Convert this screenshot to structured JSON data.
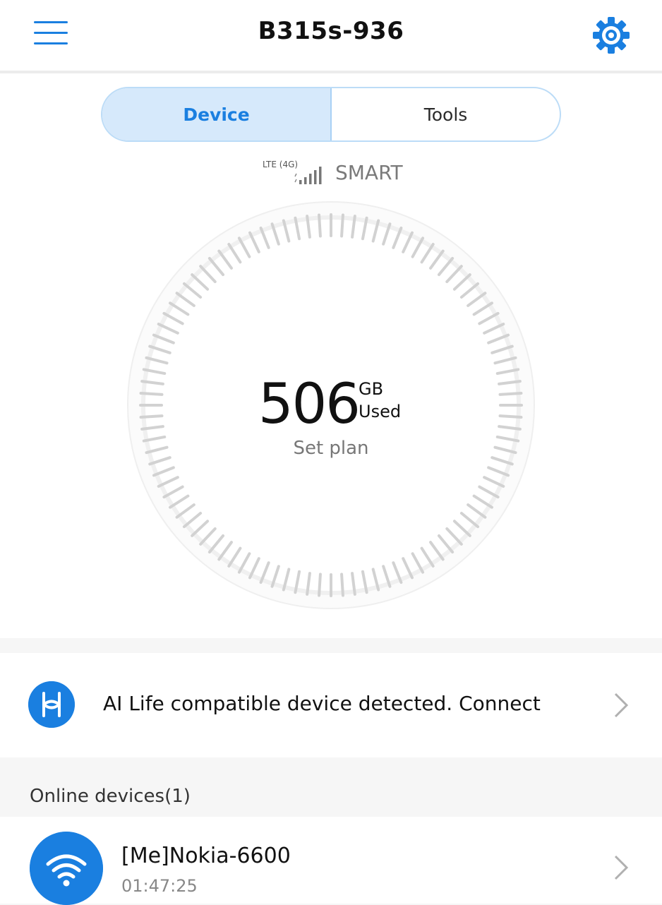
{
  "header": {
    "title": "B315s-936",
    "menu_icon": "hamburger-menu-icon",
    "settings_icon": "gear-icon"
  },
  "tabs": [
    {
      "label": "Device",
      "active": true
    },
    {
      "label": "Tools",
      "active": false
    }
  ],
  "network": {
    "type": "LTE (4G)",
    "carrier": "SMART",
    "signal_icon": "signal-bars-icon"
  },
  "usage": {
    "value": "506",
    "unit": "GB",
    "label": "Used",
    "set_plan": "Set plan"
  },
  "ai_life": {
    "text": "AI Life compatible device detected. Connect",
    "icon": "ai-life-logo-icon"
  },
  "online_devices": {
    "header": "Online devices(1)",
    "items": [
      {
        "name": "[Me]Nokia-6600",
        "time": "01:47:25",
        "icon": "wifi-icon"
      }
    ]
  },
  "colors": {
    "accent": "#1a7fe0",
    "tab_active_bg": "#d6e9fb",
    "background": "#f6f6f6"
  }
}
